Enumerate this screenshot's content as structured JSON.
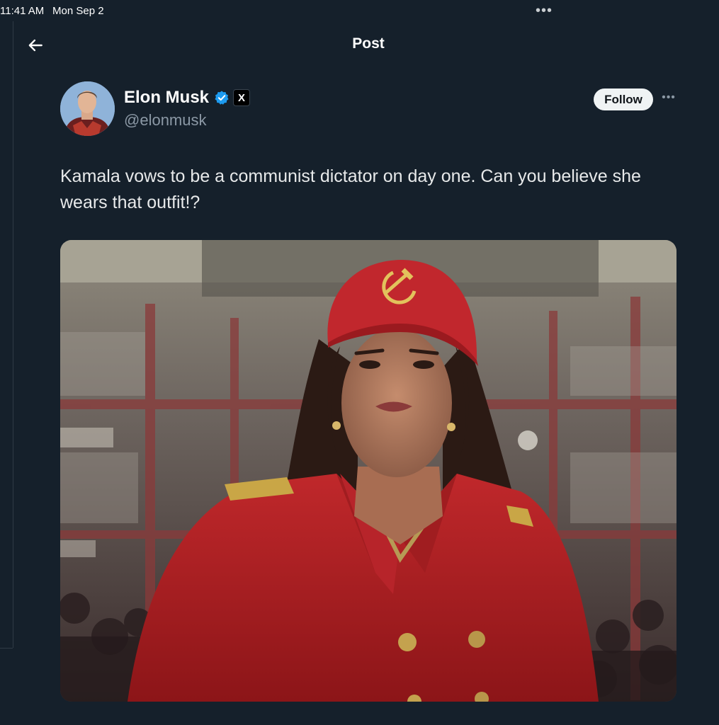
{
  "status_bar": {
    "time": "11:41 AM",
    "date": "Mon Sep 2",
    "dots": "•••"
  },
  "header": {
    "back_icon": "arrow-left-icon",
    "title": "Post"
  },
  "post": {
    "author": {
      "display_name": "Elon Musk",
      "handle": "@elonmusk",
      "verified_icon": "verified-badge-icon",
      "affiliation_badge": "X"
    },
    "follow_label": "Follow",
    "more_label": "•••",
    "text": "Kamala vows to be a communist dictator on day one. Can you believe she wears that outfit!?"
  },
  "colors": {
    "background": "#15202b",
    "verified_blue": "#1d9bf0",
    "follow_bg": "#eff3f4",
    "secondary_text": "#8b98a5"
  }
}
